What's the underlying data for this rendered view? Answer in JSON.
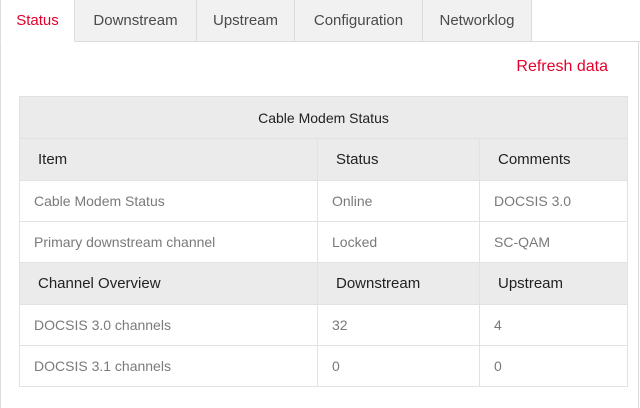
{
  "tabs": [
    {
      "label": "Status",
      "active": true
    },
    {
      "label": "Downstream",
      "active": false
    },
    {
      "label": "Upstream",
      "active": false
    },
    {
      "label": "Configuration",
      "active": false
    },
    {
      "label": "Networklog",
      "active": false
    }
  ],
  "refresh_label": "Refresh data",
  "colors": {
    "accent": "#e4002b",
    "header_bg": "#ebebeb",
    "tab_bg": "#f1f1f1"
  },
  "table": {
    "caption": "Cable Modem Status",
    "header1": [
      "Item",
      "Status",
      "Comments"
    ],
    "rows1": [
      [
        "Cable Modem Status",
        "Online",
        "DOCSIS 3.0"
      ],
      [
        "Primary downstream channel",
        "Locked",
        "SC-QAM"
      ]
    ],
    "header2": [
      "Channel Overview",
      "Downstream",
      "Upstream"
    ],
    "rows2": [
      [
        "DOCSIS 3.0 channels",
        "32",
        "4"
      ],
      [
        "DOCSIS 3.1 channels",
        "0",
        "0"
      ]
    ]
  }
}
